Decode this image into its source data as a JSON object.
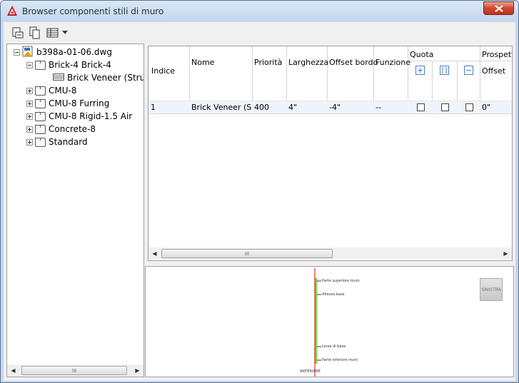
{
  "window": {
    "title": "Browser componenti stili di muro"
  },
  "toolbar": {
    "buttons": [
      "import-icon",
      "copy-icon",
      "table-view-icon"
    ]
  },
  "tree": {
    "root": "b398a-01-06.dwg",
    "expanded_style": "Brick-4 Brick-4",
    "component": "Brick Veneer (Structu",
    "styles": [
      "CMU-8",
      "CMU-8 Furring",
      "CMU-8 Rigid-1.5 Air",
      "Concrete-8",
      "Standard"
    ]
  },
  "grid": {
    "headers": {
      "indice": "Indice",
      "nome": "Nome",
      "priorita": "Priorità",
      "larghezza": "Larghezza",
      "offset_bordo": "Offset bordo",
      "funzione": "Funzione",
      "quota": "Quota",
      "prospetto": "Prospett",
      "offset": "Offset"
    },
    "row": {
      "indice": "1",
      "nome": "Brick Veneer (St...",
      "priorita": "400",
      "larghezza": "4\"",
      "offset_bordo": "-4\"",
      "funzione": "--",
      "offset": "0\""
    },
    "scroll_thumb": "III"
  },
  "tree_scroll_thumb": "III",
  "preview": {
    "labels": [
      "Parte superiore muro",
      "Altezza base",
      "Linea di base",
      "Parte inferiore muro",
      "SINISTRA"
    ],
    "bottom_label": "ANTERIORE",
    "colors": {
      "component_line": "#8fd14a",
      "edge_line": "#cc0000"
    }
  }
}
